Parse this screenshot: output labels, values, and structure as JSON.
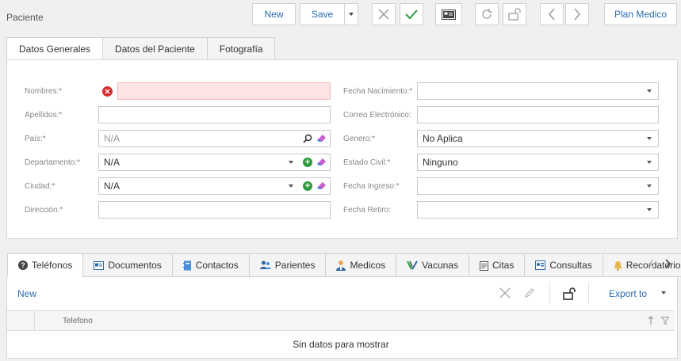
{
  "header": {
    "title": "Paciente"
  },
  "toolbar": {
    "new_label": "New",
    "save_label": "Save",
    "plan_label": "Plan Medico"
  },
  "tabs_main": [
    {
      "label": "Datos Generales",
      "active": true
    },
    {
      "label": "Datos del Paciente",
      "active": false
    },
    {
      "label": "Fotografía",
      "active": false
    }
  ],
  "form": {
    "nombres_label": "Nombres:*",
    "apellidos_label": "Apellidos:*",
    "pais_label": "País:*",
    "pais_placeholder": "N/A",
    "departamento_label": "Departamento:*",
    "departamento_value": "N/A",
    "ciudad_label": "Ciudad:*",
    "ciudad_value": "N/A",
    "direccion_label": "Dirección:*",
    "fecha_nac_label": "Fecha Nacimiento:*",
    "correo_label": "Correo Electrónico:",
    "genero_label": "Genero:*",
    "genero_value": "No Aplica",
    "estado_label": "Estado Civil:*",
    "estado_value": "Ninguno",
    "fecha_ingreso_label": "Fecha Ingreso:*",
    "fecha_retiro_label": "Fecha Retiro:"
  },
  "tabs_detail": [
    {
      "label": "Teléfonos",
      "icon": "question-icon"
    },
    {
      "label": "Documentos",
      "icon": "id-card-icon"
    },
    {
      "label": "Contactos",
      "icon": "address-book-icon"
    },
    {
      "label": "Parientes",
      "icon": "users-icon"
    },
    {
      "label": "Medicos",
      "icon": "doctor-icon"
    },
    {
      "label": "Vacunas",
      "icon": "syringe-icon"
    },
    {
      "label": "Citas",
      "icon": "calendar-icon"
    },
    {
      "label": "Consultas",
      "icon": "consult-icon"
    },
    {
      "label": "Recordatorios",
      "icon": "bell-icon"
    }
  ],
  "grid": {
    "new_label": "New",
    "export_label": "Export to",
    "column_header": "Telefono",
    "empty_text": "Sin datos para mostrar"
  },
  "colors": {
    "accent": "#2b6cb0",
    "success": "#2e9c3e",
    "error": "#d32f2f"
  }
}
